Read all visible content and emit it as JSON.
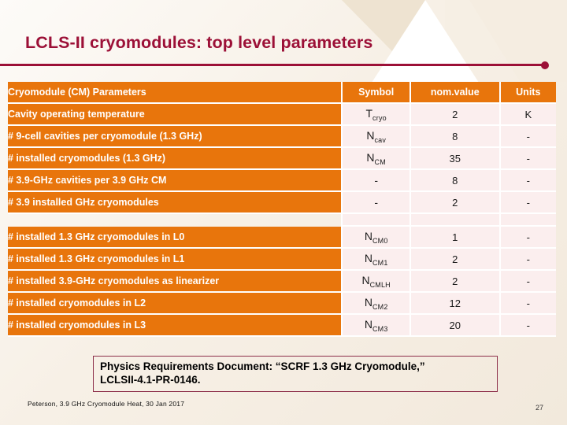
{
  "slide": {
    "title": "LCLS-II cryomodules: top level parameters",
    "page_number": "27",
    "footnote": "Peterson, 3.9 GHz Cryomodule Heat, 30 Jan 2017",
    "accent_color": "#e8750c",
    "title_color": "#9c1037",
    "data_cell_color": "#fbeeee"
  },
  "table": {
    "headers": {
      "parameter": "Cryomodule (CM) Parameters",
      "symbol": "Symbol",
      "value": "nom.value",
      "units": "Units"
    },
    "rows": [
      {
        "parameter": "Cavity operating temperature",
        "symbol_base": "T",
        "symbol_sub": "cryo",
        "value": "2",
        "units": "K"
      },
      {
        "parameter": "# 9-cell cavities per cryomodule (1.3 GHz)",
        "symbol_base": "N",
        "symbol_sub": "cav",
        "value": "8",
        "units": "-"
      },
      {
        "parameter": "# installed cryomodules (1.3 GHz)",
        "symbol_base": "N",
        "symbol_sub": "CM",
        "value": "35",
        "units": "-"
      },
      {
        "parameter": "# 3.9-GHz cavities per 3.9 GHz CM",
        "symbol_base": "-",
        "symbol_sub": "",
        "value": "8",
        "units": "-"
      },
      {
        "parameter": "# 3.9 installed GHz cryomodules",
        "symbol_base": "-",
        "symbol_sub": "",
        "value": "2",
        "units": "-"
      },
      {
        "parameter": "",
        "symbol_base": "",
        "symbol_sub": "",
        "value": "",
        "units": "",
        "spacer": true
      },
      {
        "parameter": "# installed 1.3 GHz cryomodules in L0",
        "symbol_base": "N",
        "symbol_sub": "CM0",
        "value": "1",
        "units": "-"
      },
      {
        "parameter": "# installed 1.3 GHz cryomodules in L1",
        "symbol_base": "N",
        "symbol_sub": "CM1",
        "value": "2",
        "units": "-"
      },
      {
        "parameter": "# installed 3.9-GHz cryomodules as linearizer",
        "symbol_base": "N",
        "symbol_sub": "CMLH",
        "value": "2",
        "units": "-"
      },
      {
        "parameter": "# installed cryomodules in L2",
        "symbol_base": "N",
        "symbol_sub": "CM2",
        "value": "12",
        "units": "-"
      },
      {
        "parameter": "# installed cryomodules in L3",
        "symbol_base": "N",
        "symbol_sub": "CM3",
        "value": "20",
        "units": "-"
      }
    ]
  },
  "callout": {
    "line1": "Physics Requirements Document: “SCRF 1.3 GHz Cryomodule,”",
    "line2": "LCLSII-4.1-PR-0146."
  }
}
